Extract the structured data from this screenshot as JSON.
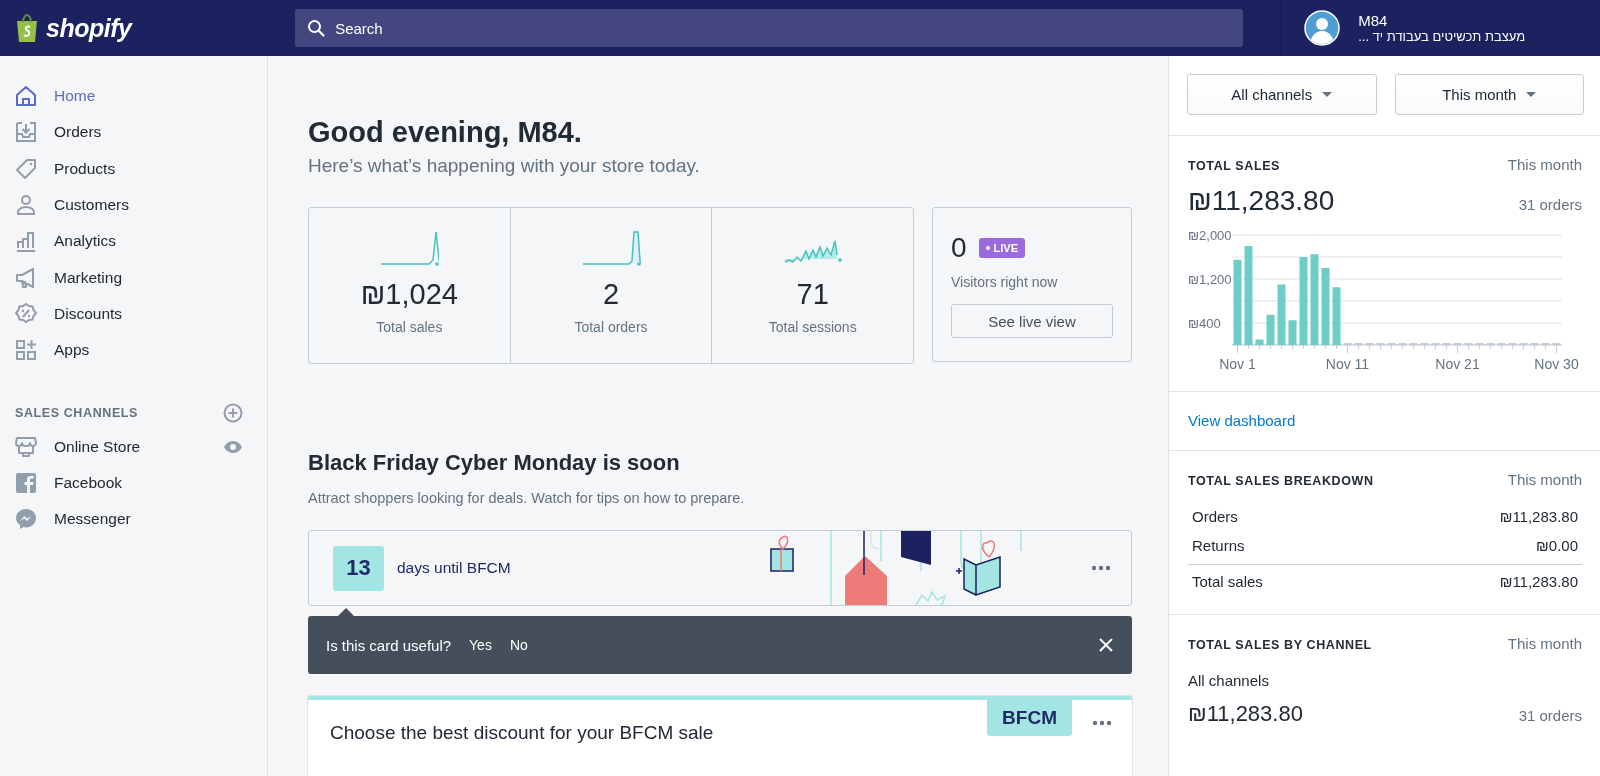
{
  "topbar": {
    "logo": "shopify",
    "search": {
      "placeholder": "Search"
    },
    "account": {
      "name": "M84",
      "store": "מעצבת תכשיטים בעבודת יד ..."
    }
  },
  "sidebar": {
    "items": [
      {
        "label": "Home",
        "selected": true
      },
      {
        "label": "Orders",
        "selected": false
      },
      {
        "label": "Products",
        "selected": false
      },
      {
        "label": "Customers",
        "selected": false
      },
      {
        "label": "Analytics",
        "selected": false
      },
      {
        "label": "Marketing",
        "selected": false
      },
      {
        "label": "Discounts",
        "selected": false
      },
      {
        "label": "Apps",
        "selected": false
      }
    ],
    "sales_channels": {
      "heading": "SALES CHANNELS",
      "items": [
        {
          "label": "Online Store",
          "selected": false
        },
        {
          "label": "Facebook",
          "selected": false
        },
        {
          "label": "Messenger",
          "selected": false
        }
      ]
    }
  },
  "greeting": {
    "title": "Good evening, M84.",
    "subtitle": "Here’s what’s happening with your store today."
  },
  "stats": [
    {
      "value": "₪1,024",
      "label": "Total sales"
    },
    {
      "value": "2",
      "label": "Total orders"
    },
    {
      "value": "71",
      "label": "Total sessions"
    }
  ],
  "live": {
    "count": "0",
    "badge": "LIVE",
    "label": "Visitors right now",
    "button": "See live view"
  },
  "bfcm": {
    "title": "Black Friday Cyber Monday is soon",
    "subtitle": "Attract shoppers looking for deals. Watch for tips on how to prepare.",
    "countdown": {
      "days": "13",
      "text": "days until BFCM"
    },
    "feedback": {
      "question": "Is this card useful?",
      "yes": "Yes",
      "no": "No"
    },
    "card": {
      "tag": "BFCM",
      "title": "Choose the best discount for your BFCM sale"
    }
  },
  "right": {
    "filters": [
      "All channels",
      "This month"
    ],
    "total_sales": {
      "heading": "TOTAL SALES",
      "period": "This month",
      "amount": "₪11,283.80",
      "orders": "31 orders",
      "chart_data": {
        "type": "bar",
        "categories": [
          "Nov 1",
          null,
          null,
          null,
          null,
          null,
          null,
          null,
          null,
          null,
          "Nov 11",
          null,
          null,
          null,
          null,
          null,
          null,
          null,
          null,
          null,
          "Nov 21",
          null,
          null,
          null,
          null,
          null,
          null,
          null,
          null,
          "Nov 30"
        ],
        "series": [
          {
            "color": "#6fcdc8",
            "values": [
              1550,
              1800,
              100,
              550,
              1100,
              450,
              1600,
              1650,
              1400,
              1050,
              0,
              0,
              0,
              0,
              0,
              0,
              0,
              0,
              0,
              0,
              0,
              0,
              0,
              0,
              0,
              0,
              0,
              0,
              0,
              0
            ]
          }
        ],
        "ylim": [
          0,
          2000
        ],
        "yticks": [
          {
            "value": 400,
            "label": "₪400"
          },
          {
            "value": 1200,
            "label": "₪1,200"
          },
          {
            "value": 2000,
            "label": "₪2,000"
          }
        ]
      }
    },
    "link": "View dashboard",
    "breakdown": {
      "heading": "TOTAL SALES BREAKDOWN",
      "period": "This month",
      "rows": [
        {
          "label": "Orders",
          "value": "₪11,283.80"
        },
        {
          "label": "Returns",
          "value": "₪0.00"
        }
      ],
      "total": {
        "label": "Total sales",
        "value": "₪11,283.80"
      }
    },
    "by_channel": {
      "heading": "TOTAL SALES BY CHANNEL",
      "period": "This month",
      "channel": "All channels",
      "amount": "₪11,283.80",
      "orders": "31 orders"
    }
  }
}
